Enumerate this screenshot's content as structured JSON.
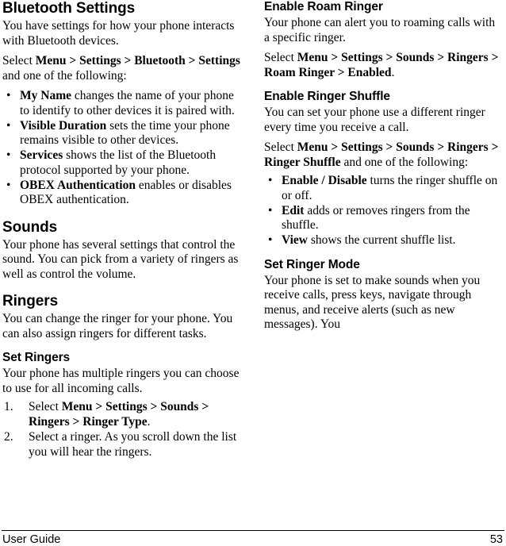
{
  "document": {
    "footer": {
      "label": "User Guide",
      "page_number": "53"
    }
  },
  "left_column": {
    "bluetooth": {
      "heading": "Bluetooth Settings",
      "intro": "You have settings for how your phone interacts with Bluetooth devices.",
      "select_prefix": "Select ",
      "select_path": "Menu > Settings > Bluetooth > Settings",
      "select_suffix": " and one of the following:",
      "bullets": [
        {
          "bullet": "•",
          "term": "My Name",
          "text": " changes the name of your phone to identify to other devices it is paired with."
        },
        {
          "bullet": "•",
          "term": "Visible Duration",
          "text": " sets the time your phone remains visible to other devices."
        },
        {
          "bullet": "•",
          "term": "Services",
          "text": " shows the list of the Bluetooth protocol supported by your phone."
        },
        {
          "bullet": "•",
          "term": "OBEX Authentication",
          "text": " enables or disables OBEX authentication."
        }
      ]
    },
    "sounds": {
      "heading": "Sounds",
      "intro": "Your phone has several settings that control the sound. You can pick from a variety of ringers as well as control the volume."
    },
    "ringers": {
      "heading": "Ringers",
      "intro": "You can change the ringer for your phone. You can also assign ringers for different tasks."
    },
    "set_ringers": {
      "heading": "Set Ringers",
      "intro": "Your phone has multiple ringers you can choose to use for all incoming calls.",
      "steps": [
        {
          "num": "1.",
          "prefix": "Select ",
          "path": "Menu > Settings > Sounds > Ringers > Ringer Type",
          "suffix": "."
        },
        {
          "num": "2.",
          "prefix": "",
          "path": "",
          "suffix": "Select a ringer. As you scroll down the list you will hear the ringers."
        }
      ]
    }
  },
  "right_column": {
    "roam_ringer": {
      "heading": "Enable Roam Ringer",
      "intro": "Your phone can alert you to roaming calls with a specific ringer.",
      "select_prefix": "Select ",
      "select_path": "Menu > Settings > Sounds > Ringers > Roam Ringer > Enabled",
      "select_suffix": "."
    },
    "ringer_shuffle": {
      "heading": "Enable Ringer Shuffle",
      "intro": "You can set your phone use a different ringer every time you receive a call.",
      "select_prefix": "Select ",
      "select_path": "Menu > Settings > Sounds > Ringers > Ringer Shuffle",
      "select_suffix": " and one of the following:",
      "bullets": [
        {
          "bullet": "•",
          "term": "Enable / Disable",
          "text": " turns the ringer shuffle on or off."
        },
        {
          "bullet": "•",
          "term": "Edit",
          "text": " adds or removes ringers from the shuffle."
        },
        {
          "bullet": "•",
          "term": "View",
          "text": " shows the current shuffle list."
        }
      ]
    },
    "ringer_mode": {
      "heading": "Set Ringer Mode",
      "intro": "Your phone is set to make sounds when you receive calls, press keys, navigate through menus, and receive alerts (such as new messages). You"
    }
  }
}
